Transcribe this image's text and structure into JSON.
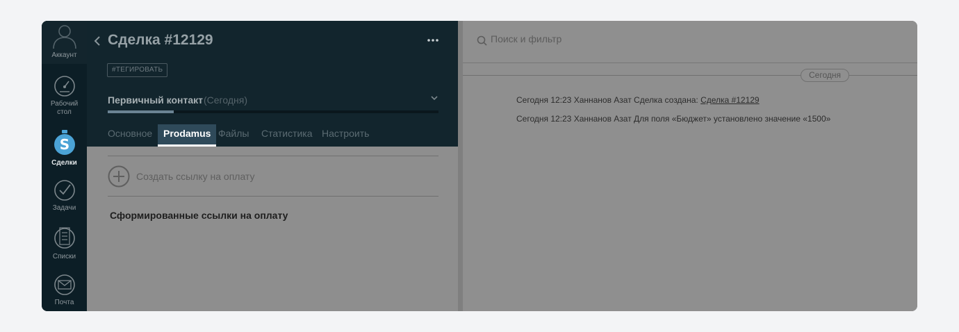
{
  "sidebar": {
    "items": [
      {
        "label": "Аккаунт",
        "icon": "user-icon"
      },
      {
        "label_line1": "Рабочий",
        "label_line2": "стол",
        "icon": "dashboard-gauge-icon"
      },
      {
        "label": "Сделки",
        "icon": "dollar-icon"
      },
      {
        "label": "Задачи",
        "icon": "checkmark-icon"
      },
      {
        "label": "Списки",
        "icon": "list-icon"
      },
      {
        "label": "Почта",
        "icon": "mail-icon"
      }
    ]
  },
  "card": {
    "title": "Сделка #12129",
    "tag_button": "#ТЕГИРОВАТЬ",
    "stage": {
      "name": "Первичный контакт",
      "date": "(Сегодня)",
      "progress": 0.2
    },
    "tabs": [
      {
        "label": "Основное",
        "active": false
      },
      {
        "label": "Prodamus",
        "active": true
      },
      {
        "label": "Файлы",
        "active": false
      },
      {
        "label": "Статистика",
        "active": false
      },
      {
        "label": "Настроить",
        "active": false
      }
    ],
    "create_link_label": "Создать ссылку на оплату",
    "links_section_title": "Сформированные ссылки на оплату"
  },
  "feed": {
    "search_placeholder": "Поиск и фильтр",
    "date_divider": "Сегодня",
    "events": [
      {
        "text": "Сегодня 12:23 Ханнанов Азат Сделка создана: ",
        "link": "Сделка #12129"
      },
      {
        "text": "Сегодня 12:23 Ханнанов Азат Для поля «Бюджет» установлено значение «1500»",
        "link": ""
      }
    ]
  },
  "colors": {
    "sidebar_bg": "#0c1e26",
    "card_header_bg": "#12252d",
    "overlay_gray": "#8f8f8f",
    "active_tab_bg": "#2f4a5a",
    "leads_icon_accent": "#4ba3d6"
  }
}
